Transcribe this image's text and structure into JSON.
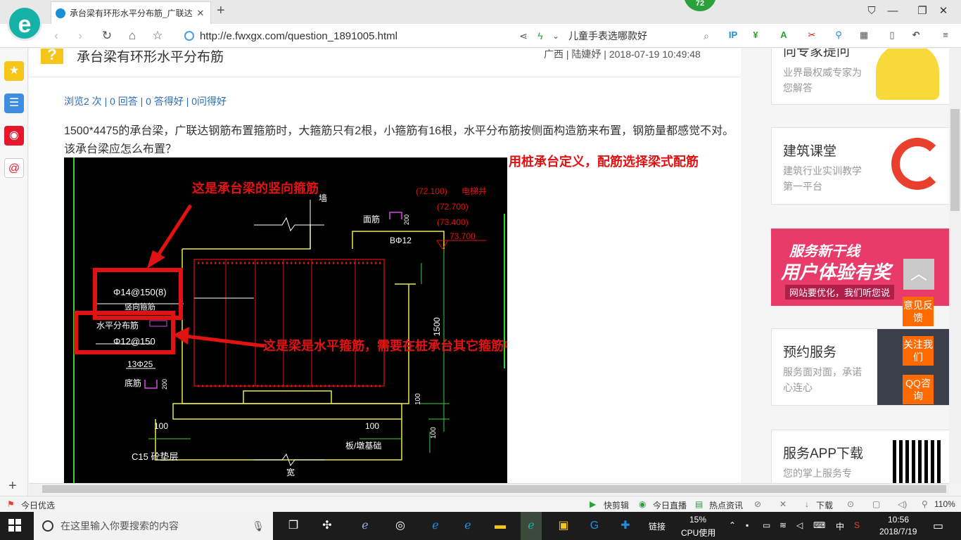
{
  "browser": {
    "tab_title": "承台梁有环形水平分布筋_广联达",
    "badge": "72",
    "url": "http://e.fwxgx.com/question_1891005.html",
    "search_text": "儿童手表选哪款好",
    "logo_letter": "e"
  },
  "question": {
    "title": "承台梁有环形水平分布筋",
    "meta": "广西 | 陆婕妤 | 2018-07-19 10:49:48",
    "stats": "浏览2 次 | 0 回答 | 0 答得好 | 0问得好",
    "body": "1500*4475的承台梁，广联达钢筋布置箍筋时，大箍筋只有2根，小箍筋有16根，水平分布筋按侧面构造筋来布置，钢筋量都感觉不对。该承台梁应怎么布置？",
    "side_note": "用桩承台定义，配筋选择梁式配筋"
  },
  "cad": {
    "annot_top": "这是承台梁的竖向箍筋",
    "annot_mid": "这是梁是水平箍筋，需要在桩承台其它箍筋中计算输入",
    "box1_line1": "Φ14@150(8)",
    "box1_line2": "竖向箍筋",
    "box2_line1": "水平分布筋",
    "box2_line2": "Φ12@150",
    "elev1": "(72.100)",
    "elev_label": "电梯井",
    "elev2": "(72.700)",
    "elev3": "(73.400)",
    "elev4": "73.700",
    "top_bar": "面筋",
    "bphi": "BΦ12",
    "top_200": "200",
    "bottom_bars": "13Φ25",
    "bottom_label": "底筋",
    "bottom_200": "200",
    "h1500": "1500",
    "d100a": "100",
    "d100b": "100",
    "d100c": "100",
    "d100d": "100",
    "width_label": "宽",
    "c15": "C15 砼垫层",
    "foundation": "板/墩基础",
    "top_mark": "墙"
  },
  "right": {
    "card1_title": "向专家提问",
    "card1_sub": "业界最权威专家为您解答",
    "card2_title": "建筑课堂",
    "card2_sub": "建筑行业实训教学第一平台",
    "banner_line1": "服务新干线",
    "banner_line2": "用户体验有奖",
    "banner_line3": "网站要优化，我们听您说",
    "card3_title": "预约服务",
    "card3_sub": "服务面对面，承诺心连心",
    "card4_title": "服务APP下载",
    "card4_sub": "您的掌上服务专",
    "float1": "意见反馈",
    "float2": "关注我们",
    "float3": "QQ咨询"
  },
  "statusbar": {
    "left": "今日优选",
    "items": [
      "快剪辑",
      "今日直播",
      "热点资讯",
      "下载"
    ],
    "zoom": "110%"
  },
  "taskbar": {
    "search_placeholder": "在这里输入你要搜索的内容",
    "link": "链接",
    "cpu_pct": "15%",
    "cpu_label": "CPU使用",
    "ime": "中",
    "time": "10:56",
    "date": "2018/7/19"
  },
  "colors": {
    "accent": "#17b2a7",
    "link": "#2a6ebb",
    "red": "#e21212",
    "orange": "#ff6a00",
    "badge": "#2aa13a"
  }
}
